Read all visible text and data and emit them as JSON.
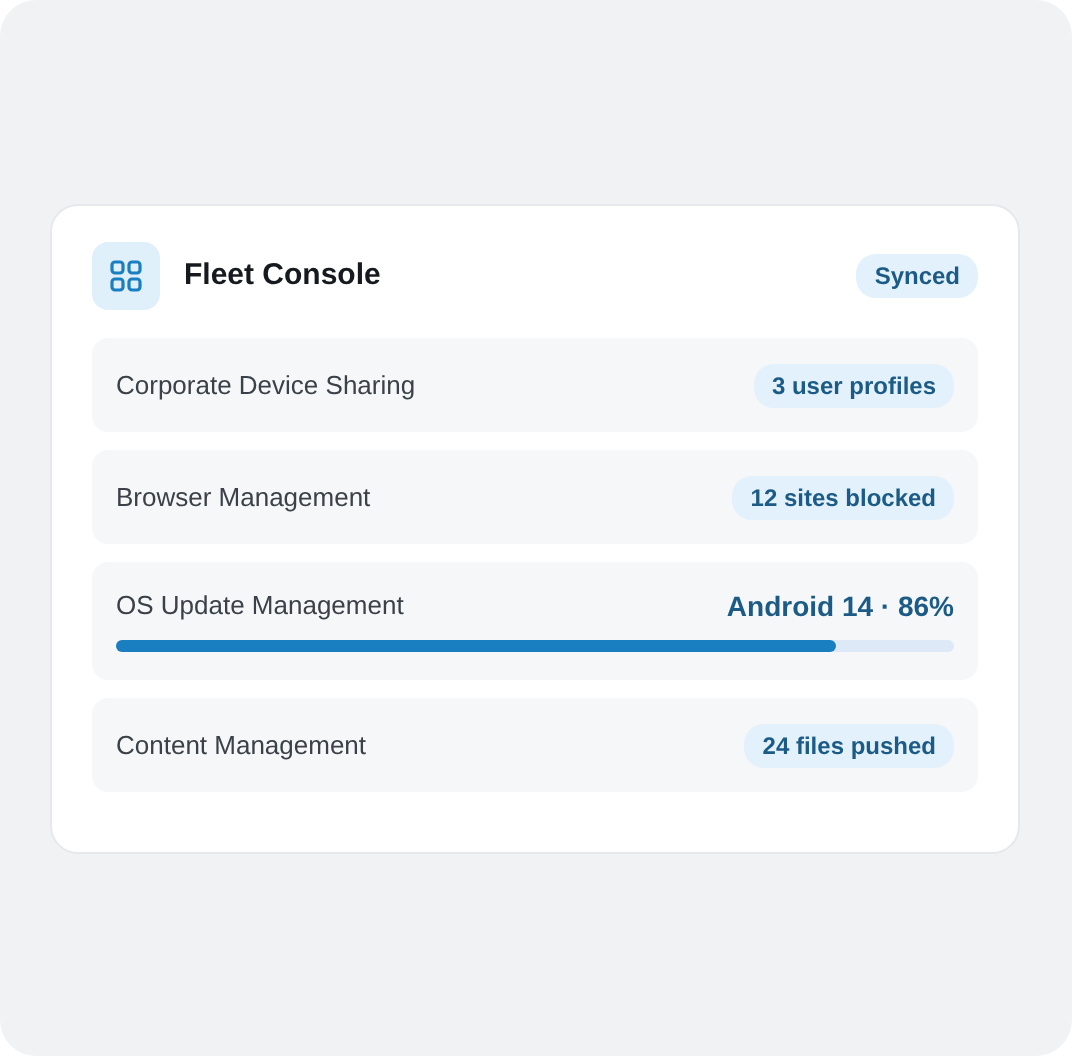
{
  "card": {
    "title": "Fleet Console",
    "status": "Synced"
  },
  "rows": [
    {
      "kind": "badge",
      "label": "Corporate Device Sharing",
      "value": "3 user profiles"
    },
    {
      "kind": "badge",
      "label": "Browser Management",
      "value": "12 sites blocked"
    },
    {
      "kind": "progress",
      "label": "OS Update Management",
      "value": "Android 14 · 86%",
      "level": 0.86
    },
    {
      "kind": "badge",
      "label": "Content Management",
      "value": "24 files pushed"
    }
  ]
}
